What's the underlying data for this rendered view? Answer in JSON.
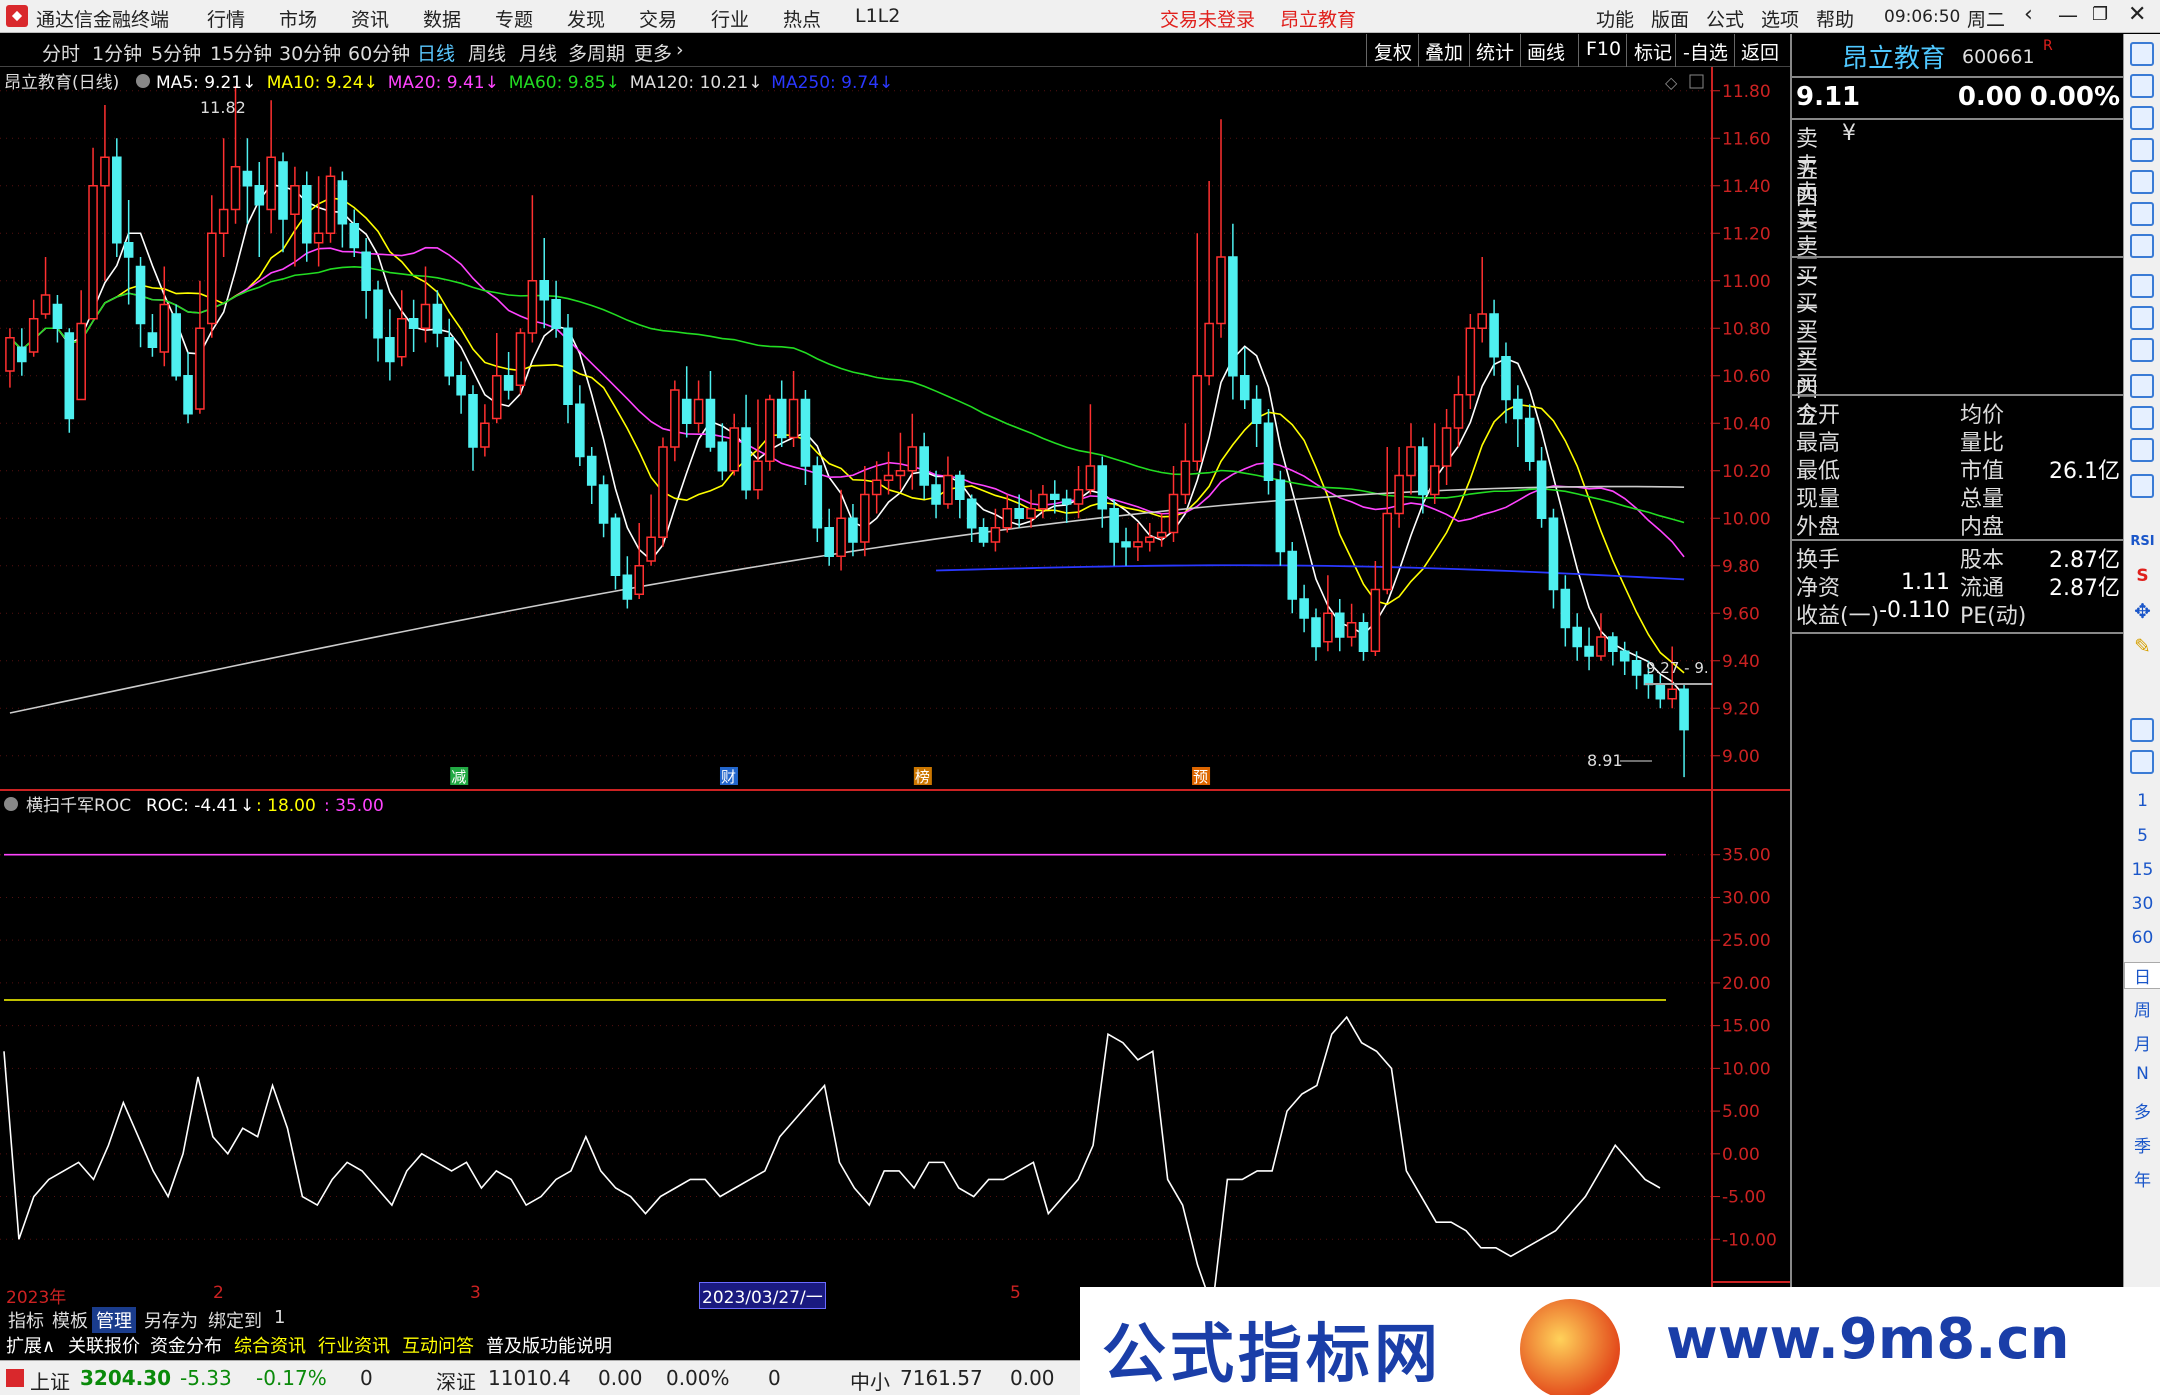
{
  "window": {
    "title": "通达信金融终端",
    "menu_left": [
      "行情",
      "市场",
      "资讯",
      "数据",
      "专题",
      "发现",
      "交易",
      "行业",
      "热点",
      "L1L2"
    ],
    "login_status": "交易未登录",
    "stock_center": "昂立教育",
    "menu_right": [
      "功能",
      "版面",
      "公式",
      "选项",
      "帮助"
    ],
    "time": "09:06:50",
    "weekday": "周二"
  },
  "periods": {
    "items": [
      "分时",
      "1分钟",
      "5分钟",
      "15分钟",
      "30分钟",
      "60分钟",
      "日线",
      "周线",
      "月线",
      "多周期",
      "更多"
    ],
    "active": "日线",
    "right_buttons": [
      "复权",
      "叠加",
      "统计",
      "画线",
      "F10",
      "标记",
      "-自选",
      "返回"
    ]
  },
  "main": {
    "stock_label": "昂立教育(日线)",
    "ma": [
      {
        "name": "MA5: 9.21",
        "color": "#ffffff"
      },
      {
        "name": "MA10: 9.24",
        "color": "#ffff00"
      },
      {
        "name": "MA20: 9.41",
        "color": "#ff44ff"
      },
      {
        "name": "MA60: 9.85",
        "color": "#22dd22"
      },
      {
        "name": "MA120: 10.21",
        "color": "#dddddd"
      },
      {
        "name": "MA250: 9.74",
        "color": "#2a38ff"
      }
    ],
    "y_ticks": [
      "11.80",
      "11.60",
      "11.40",
      "11.20",
      "11.00",
      "10.80",
      "10.60",
      "10.40",
      "10.20",
      "10.00",
      "9.80",
      "9.60",
      "9.40",
      "9.20",
      "9.00"
    ],
    "high_label": "11.82",
    "low_label": "8.91",
    "price_tag": "9.27 - 9.",
    "events": [
      {
        "text": "减",
        "color": "#22aa44"
      },
      {
        "text": "财",
        "color": "#2266cc"
      },
      {
        "text": "榜",
        "color": "#cc7700"
      },
      {
        "text": "预",
        "color": "#dd6600"
      }
    ]
  },
  "indicator": {
    "label": "横扫千军ROC",
    "roc": "ROC: -4.41",
    "v1": ": 18.00",
    "v2": ": 35.00",
    "y_ticks": [
      "35.00",
      "30.00",
      "25.00",
      "20.00",
      "15.00",
      "10.00",
      "5.00",
      "0.00",
      "-5.00",
      "-10.00"
    ]
  },
  "xaxis": {
    "year": "2023年",
    "m2": "2",
    "m3": "3",
    "date_box": "2023/03/27/一",
    "m5": "5"
  },
  "quote": {
    "name": "昂立教育",
    "code": "600661",
    "flag": "R",
    "price": "9.11",
    "change": "0.00",
    "pct": "0.00%",
    "sell_rows": [
      "卖五",
      "卖四",
      "卖三",
      "卖二",
      "卖一"
    ],
    "sell_marker": "¥",
    "buy_rows": [
      "买一",
      "买二",
      "买三",
      "买四",
      "买五"
    ],
    "stats": [
      {
        "l": "今开",
        "m": "均价",
        "v": ""
      },
      {
        "l": "最高",
        "m": "量比",
        "v": ""
      },
      {
        "l": "最低",
        "m": "市值",
        "v": "26.1亿"
      },
      {
        "l": "现量",
        "m": "总量",
        "v": ""
      },
      {
        "l": "外盘",
        "m": "内盘",
        "v": ""
      }
    ],
    "stats2": [
      {
        "l": "换手",
        "lv": "",
        "m": "股本",
        "v": "2.87亿"
      },
      {
        "l": "净资",
        "lv": "1.11",
        "m": "流通",
        "v": "2.87亿"
      },
      {
        "l": "收益(一)",
        "lv": "-0.110",
        "m": "PE(动)",
        "v": ""
      }
    ]
  },
  "right_tools": {
    "labels": [
      "1",
      "5",
      "15",
      "30",
      "60",
      "日",
      "周",
      "月",
      "N",
      "多",
      "季",
      "年"
    ],
    "top_labels": [
      "RSI",
      "S"
    ]
  },
  "bottom": {
    "row1": [
      "指标",
      "模板",
      "管理",
      "另存为",
      "绑定到",
      "1"
    ],
    "row2": [
      "扩展∧",
      "关联报价",
      "资金分布",
      "综合资讯",
      "行业资讯",
      "互动问答",
      "普及版功能说明"
    ]
  },
  "status": {
    "sh_name": "上证",
    "sh_val": "3204.30",
    "sh_chg": "-5.33",
    "sh_pct": "-0.17%",
    "sh_vol": "0",
    "sz_name": "深证",
    "sz_val": "11010.4",
    "sz_chg": "0.00",
    "sz_pct": "0.00%",
    "sz_vol": "0",
    "zx_name": "中小",
    "zx_val": "7161.57",
    "zx_chg": "0.00"
  },
  "banner": {
    "text": "公式指标网",
    "url": "www.9m8.cn"
  },
  "chart_data": {
    "type": "candlestick",
    "price_range": [
      8.86,
      11.9
    ],
    "candles": [
      [
        10.62,
        10.76,
        10.8,
        10.55
      ],
      [
        10.72,
        10.66,
        10.8,
        10.6
      ],
      [
        10.7,
        10.84,
        10.92,
        10.68
      ],
      [
        10.86,
        10.94,
        11.1,
        10.84
      ],
      [
        10.9,
        10.8,
        10.94,
        10.74
      ],
      [
        10.78,
        10.42,
        10.8,
        10.36
      ],
      [
        10.5,
        10.82,
        10.96,
        10.5
      ],
      [
        10.84,
        11.4,
        11.56,
        10.84
      ],
      [
        11.4,
        11.52,
        11.74,
        11.0
      ],
      [
        11.52,
        11.16,
        11.6,
        11.1
      ],
      [
        11.16,
        11.1,
        11.34,
        10.9
      ],
      [
        11.06,
        10.82,
        11.1,
        10.72
      ],
      [
        10.78,
        10.72,
        10.86,
        10.68
      ],
      [
        10.7,
        10.9,
        11.06,
        10.64
      ],
      [
        10.86,
        10.6,
        10.9,
        10.58
      ],
      [
        10.6,
        10.44,
        10.7,
        10.4
      ],
      [
        10.46,
        10.8,
        11.0,
        10.44
      ],
      [
        10.82,
        11.2,
        11.36,
        10.76
      ],
      [
        11.2,
        11.3,
        11.6,
        11.1
      ],
      [
        11.3,
        11.48,
        11.82,
        11.24
      ],
      [
        11.46,
        11.4,
        11.6,
        11.24
      ],
      [
        11.4,
        11.32,
        11.5,
        11.1
      ],
      [
        11.3,
        11.52,
        11.76,
        11.2
      ],
      [
        11.5,
        11.26,
        11.54,
        11.12
      ],
      [
        11.28,
        11.4,
        11.48,
        11.06
      ],
      [
        11.4,
        11.16,
        11.46,
        11.08
      ],
      [
        11.16,
        11.2,
        11.44,
        11.06
      ],
      [
        11.2,
        11.44,
        11.48,
        11.16
      ],
      [
        11.42,
        11.24,
        11.46,
        11.14
      ],
      [
        11.24,
        11.14,
        11.3,
        11.1
      ],
      [
        11.12,
        10.96,
        11.18,
        10.84
      ],
      [
        10.96,
        10.76,
        11.0,
        10.66
      ],
      [
        10.76,
        10.66,
        10.88,
        10.58
      ],
      [
        10.68,
        10.84,
        10.96,
        10.64
      ],
      [
        10.84,
        10.8,
        10.92,
        10.7
      ],
      [
        10.8,
        10.9,
        11.06,
        10.74
      ],
      [
        10.9,
        10.78,
        10.96,
        10.72
      ],
      [
        10.76,
        10.6,
        10.84,
        10.56
      ],
      [
        10.6,
        10.52,
        10.66,
        10.44
      ],
      [
        10.52,
        10.3,
        10.56,
        10.2
      ],
      [
        10.3,
        10.4,
        10.48,
        10.26
      ],
      [
        10.42,
        10.6,
        10.78,
        10.4
      ],
      [
        10.6,
        10.54,
        10.7,
        10.5
      ],
      [
        10.56,
        10.78,
        10.8,
        10.52
      ],
      [
        10.78,
        11.0,
        11.36,
        10.74
      ],
      [
        11.0,
        10.92,
        11.18,
        10.8
      ],
      [
        10.92,
        10.8,
        11.0,
        10.76
      ],
      [
        10.8,
        10.48,
        10.86,
        10.4
      ],
      [
        10.48,
        10.26,
        10.56,
        10.22
      ],
      [
        10.26,
        10.14,
        10.3,
        10.06
      ],
      [
        10.14,
        9.98,
        10.18,
        9.92
      ],
      [
        10.0,
        9.76,
        10.02,
        9.7
      ],
      [
        9.76,
        9.66,
        9.84,
        9.62
      ],
      [
        9.68,
        9.8,
        9.98,
        9.66
      ],
      [
        9.82,
        9.92,
        10.1,
        9.8
      ],
      [
        9.92,
        10.3,
        10.34,
        9.88
      ],
      [
        10.3,
        10.54,
        10.58,
        10.24
      ],
      [
        10.5,
        10.4,
        10.64,
        10.34
      ],
      [
        10.4,
        10.5,
        10.58,
        10.36
      ],
      [
        10.5,
        10.3,
        10.62,
        10.28
      ],
      [
        10.32,
        10.2,
        10.4,
        10.16
      ],
      [
        10.2,
        10.38,
        10.44,
        10.18
      ],
      [
        10.38,
        10.12,
        10.52,
        10.08
      ],
      [
        10.12,
        10.24,
        10.5,
        10.08
      ],
      [
        10.24,
        10.5,
        10.52,
        10.2
      ],
      [
        10.5,
        10.34,
        10.58,
        10.3
      ],
      [
        10.34,
        10.5,
        10.62,
        10.3
      ],
      [
        10.5,
        10.22,
        10.54,
        10.14
      ],
      [
        10.22,
        9.96,
        10.26,
        9.9
      ],
      [
        9.96,
        9.84,
        10.04,
        9.8
      ],
      [
        9.84,
        10.0,
        10.12,
        9.78
      ],
      [
        10.0,
        9.9,
        10.06,
        9.84
      ],
      [
        9.9,
        10.1,
        10.22,
        9.84
      ],
      [
        10.1,
        10.16,
        10.24,
        10.02
      ],
      [
        10.16,
        10.18,
        10.28,
        10.1
      ],
      [
        10.18,
        10.2,
        10.36,
        10.12
      ],
      [
        10.2,
        10.3,
        10.44,
        10.12
      ],
      [
        10.3,
        10.14,
        10.36,
        10.08
      ],
      [
        10.14,
        10.06,
        10.2,
        10.0
      ],
      [
        10.06,
        10.18,
        10.26,
        10.04
      ],
      [
        10.18,
        10.08,
        10.2,
        10.0
      ],
      [
        10.08,
        9.96,
        10.1,
        9.9
      ],
      [
        9.96,
        9.9,
        10.0,
        9.88
      ],
      [
        9.9,
        9.96,
        10.04,
        9.86
      ],
      [
        9.96,
        10.04,
        10.1,
        9.94
      ],
      [
        10.04,
        10.0,
        10.1,
        9.96
      ],
      [
        10.0,
        10.04,
        10.12,
        9.96
      ],
      [
        10.04,
        10.1,
        10.14,
        10.0
      ],
      [
        10.1,
        10.08,
        10.16,
        10.02
      ],
      [
        10.08,
        10.06,
        10.12,
        9.98
      ],
      [
        10.06,
        10.12,
        10.22,
        10.0
      ],
      [
        10.12,
        10.22,
        10.48,
        10.1
      ],
      [
        10.22,
        10.04,
        10.26,
        9.96
      ],
      [
        10.04,
        9.9,
        10.08,
        9.8
      ],
      [
        9.9,
        9.88,
        9.96,
        9.8
      ],
      [
        9.88,
        9.9,
        9.98,
        9.82
      ],
      [
        9.9,
        9.92,
        9.98,
        9.86
      ],
      [
        9.92,
        9.94,
        10.02,
        9.88
      ],
      [
        9.94,
        10.1,
        10.22,
        9.9
      ],
      [
        10.1,
        10.24,
        10.4,
        10.06
      ],
      [
        10.24,
        10.6,
        11.2,
        10.2
      ],
      [
        10.6,
        10.82,
        11.42,
        10.56
      ],
      [
        10.82,
        11.1,
        11.68,
        10.76
      ],
      [
        11.1,
        10.6,
        11.24,
        10.5
      ],
      [
        10.6,
        10.5,
        10.72,
        10.46
      ],
      [
        10.5,
        10.4,
        10.56,
        10.3
      ],
      [
        10.4,
        10.16,
        10.46,
        10.1
      ],
      [
        10.16,
        9.86,
        10.2,
        9.8
      ],
      [
        9.86,
        9.66,
        9.9,
        9.6
      ],
      [
        9.66,
        9.58,
        9.72,
        9.52
      ],
      [
        9.58,
        9.46,
        9.62,
        9.4
      ],
      [
        9.48,
        9.6,
        9.76,
        9.44
      ],
      [
        9.6,
        9.5,
        9.66,
        9.44
      ],
      [
        9.5,
        9.56,
        9.64,
        9.46
      ],
      [
        9.56,
        9.44,
        9.6,
        9.4
      ],
      [
        9.44,
        9.7,
        9.82,
        9.42
      ],
      [
        9.7,
        10.02,
        10.3,
        9.68
      ],
      [
        10.02,
        10.18,
        10.3,
        9.96
      ],
      [
        10.18,
        10.3,
        10.4,
        10.1
      ],
      [
        10.3,
        10.1,
        10.34,
        10.02
      ],
      [
        10.1,
        10.22,
        10.4,
        10.06
      ],
      [
        10.22,
        10.38,
        10.46,
        10.14
      ],
      [
        10.38,
        10.52,
        10.6,
        10.3
      ],
      [
        10.52,
        10.8,
        10.86,
        10.46
      ],
      [
        10.8,
        10.86,
        11.1,
        10.74
      ],
      [
        10.86,
        10.68,
        10.92,
        10.6
      ],
      [
        10.68,
        10.5,
        10.74,
        10.4
      ],
      [
        10.5,
        10.42,
        10.56,
        10.3
      ],
      [
        10.42,
        10.24,
        10.48,
        10.2
      ],
      [
        10.24,
        10.0,
        10.3,
        9.96
      ],
      [
        10.0,
        9.7,
        10.04,
        9.62
      ],
      [
        9.7,
        9.54,
        9.76,
        9.46
      ],
      [
        9.54,
        9.46,
        9.6,
        9.4
      ],
      [
        9.46,
        9.42,
        9.54,
        9.36
      ],
      [
        9.42,
        9.5,
        9.6,
        9.4
      ],
      [
        9.5,
        9.44,
        9.52,
        9.38
      ],
      [
        9.44,
        9.4,
        9.48,
        9.34
      ],
      [
        9.4,
        9.34,
        9.44,
        9.28
      ],
      [
        9.34,
        9.3,
        9.4,
        9.24
      ],
      [
        9.3,
        9.24,
        9.34,
        9.2
      ],
      [
        9.24,
        9.28,
        9.46,
        9.2
      ],
      [
        9.28,
        9.11,
        9.3,
        8.91
      ]
    ],
    "roc": [
      12,
      -10,
      -5,
      -3,
      -2,
      -1,
      -3,
      1,
      6,
      2,
      -2,
      -5,
      0,
      9,
      2,
      0,
      3,
      2,
      8,
      3,
      -5,
      -6,
      -3,
      -1,
      -2,
      -4,
      -6,
      -2,
      0,
      -1,
      -2,
      -1,
      -4,
      -2,
      -3,
      -6,
      -5,
      -3,
      -2,
      2,
      -2,
      -4,
      -5,
      -7,
      -5,
      -4,
      -3,
      -3,
      -5,
      -4,
      -3,
      -2,
      2,
      4,
      6,
      8,
      -1,
      -4,
      -6,
      -2,
      -2,
      -4,
      -1,
      -1,
      -4,
      -5,
      -3,
      -3,
      -2,
      -1,
      -7,
      -5,
      -3,
      1,
      14,
      13,
      11,
      12,
      -3,
      -6,
      -13,
      -18,
      -3,
      -3,
      -2,
      -2,
      5,
      7,
      8,
      14,
      16,
      13,
      12,
      10,
      -2,
      -5,
      -8,
      -8,
      -9,
      -11,
      -11,
      -12,
      -11,
      -10,
      -9,
      -7,
      -5,
      -2,
      1,
      -1,
      -3,
      -4
    ]
  }
}
